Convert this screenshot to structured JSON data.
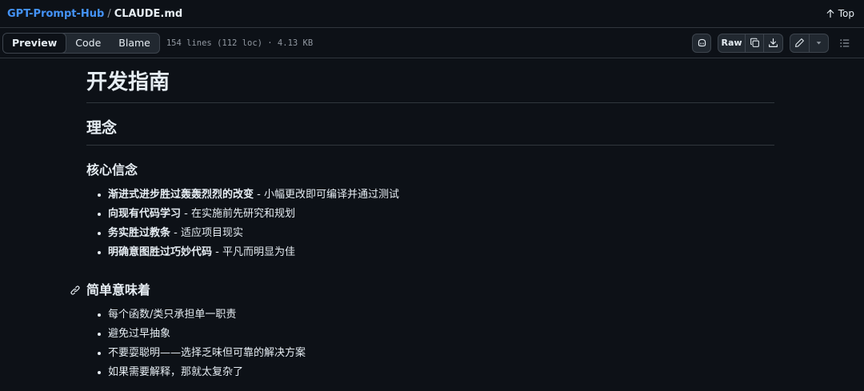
{
  "breadcrumb": {
    "repo": "GPT-Prompt-Hub",
    "separator": "/",
    "file": "CLAUDE.md"
  },
  "top_link": {
    "label": "Top",
    "icon": "arrow-up-icon"
  },
  "toolbar": {
    "tabs": [
      {
        "label": "Preview",
        "active": true
      },
      {
        "label": "Code",
        "active": false
      },
      {
        "label": "Blame",
        "active": false
      }
    ],
    "file_info": "154 lines (112 loc) · 4.13 KB",
    "raw_label": "Raw",
    "icons": [
      "copilot-icon",
      "copy-icon",
      "download-icon",
      "pencil-icon",
      "triangle-down-icon",
      "list-unordered-icon"
    ]
  },
  "doc": {
    "h1": "开发指南",
    "h2": "理念",
    "section1": {
      "heading": "核心信念",
      "items": [
        {
          "bold": "渐进式进步胜过轰轰烈烈的改变",
          "rest": " - 小幅更改即可编译并通过测试"
        },
        {
          "bold": "向现有代码学习",
          "rest": " - 在实施前先研究和规划"
        },
        {
          "bold": "务实胜过教条",
          "rest": " - 适应项目现实"
        },
        {
          "bold": "明确意图胜过巧妙代码",
          "rest": " - 平凡而明显为佳"
        }
      ]
    },
    "section2": {
      "heading": "简单意味着",
      "items": [
        "每个函数/类只承担单一职责",
        "避免过早抽象",
        "不要耍聪明——选择乏味但可靠的解决方案",
        "如果需要解释，那就太复杂了"
      ]
    }
  },
  "colors": {
    "background": "#0d1117",
    "link": "#4493f8",
    "muted": "#9198a1",
    "border": "#30363d"
  }
}
